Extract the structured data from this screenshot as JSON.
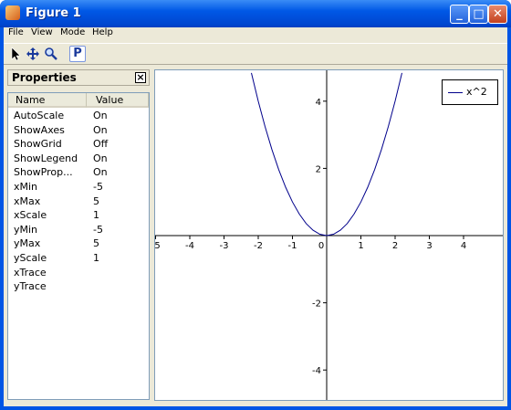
{
  "window": {
    "title": "Figure 1"
  },
  "menu": [
    "File",
    "View",
    "Mode",
    "Help"
  ],
  "toolbar": {
    "p_label": "P"
  },
  "properties": {
    "title": "Properties",
    "columns": [
      "Name",
      "Value"
    ],
    "rows": [
      {
        "name": "AutoScale",
        "value": "On"
      },
      {
        "name": "ShowAxes",
        "value": "On"
      },
      {
        "name": "ShowGrid",
        "value": "Off"
      },
      {
        "name": "ShowLegend",
        "value": "On"
      },
      {
        "name": "ShowProp...",
        "value": "On"
      },
      {
        "name": "xMin",
        "value": "-5"
      },
      {
        "name": "xMax",
        "value": "5"
      },
      {
        "name": "xScale",
        "value": "1"
      },
      {
        "name": "yMin",
        "value": "-5"
      },
      {
        "name": "yMax",
        "value": "5"
      },
      {
        "name": "yScale",
        "value": "1"
      },
      {
        "name": "xTrace",
        "value": ""
      },
      {
        "name": "yTrace",
        "value": ""
      }
    ]
  },
  "chart_data": {
    "type": "line",
    "title": "",
    "xlabel": "",
    "ylabel": "",
    "xlim": [
      -5,
      5
    ],
    "ylim": [
      -5,
      5
    ],
    "grid": false,
    "legend_placement": "top-right",
    "series": [
      {
        "name": "x^2",
        "color": "#00008b",
        "x": [
          -2.2,
          -2.0,
          -1.8,
          -1.6,
          -1.4,
          -1.2,
          -1.0,
          -0.8,
          -0.6,
          -0.4,
          -0.2,
          0.0,
          0.2,
          0.4,
          0.6,
          0.8,
          1.0,
          1.2,
          1.4,
          1.6,
          1.8,
          2.0,
          2.2
        ],
        "y": [
          4.84,
          4.0,
          3.24,
          2.56,
          1.96,
          1.44,
          1.0,
          0.64,
          0.36,
          0.16,
          0.04,
          0.0,
          0.04,
          0.16,
          0.36,
          0.64,
          1.0,
          1.44,
          1.96,
          2.56,
          3.24,
          4.0,
          4.84
        ]
      }
    ],
    "x_ticks": [
      {
        "value": -5,
        "label": "5"
      },
      {
        "value": -4,
        "label": "-4"
      },
      {
        "value": -3,
        "label": "-3"
      },
      {
        "value": -2,
        "label": "-2"
      },
      {
        "value": -1,
        "label": "-1"
      },
      {
        "value": 0,
        "label": "0"
      },
      {
        "value": 1,
        "label": "1"
      },
      {
        "value": 2,
        "label": "2"
      },
      {
        "value": 3,
        "label": "3"
      },
      {
        "value": 4,
        "label": "4"
      }
    ],
    "y_ticks": [
      {
        "value": 4,
        "label": "4"
      },
      {
        "value": 2,
        "label": "2"
      },
      {
        "value": -2,
        "label": "-2"
      },
      {
        "value": -4,
        "label": "-4"
      }
    ]
  }
}
